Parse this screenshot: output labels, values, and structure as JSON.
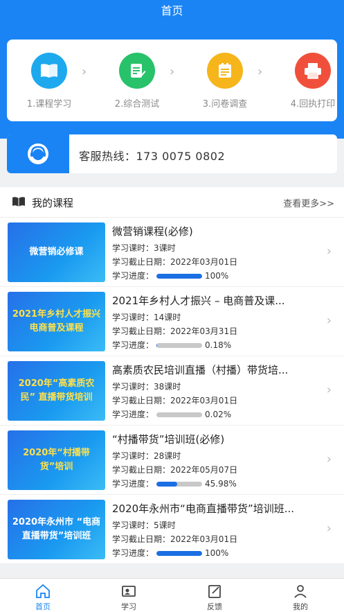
{
  "header": {
    "title": "首页"
  },
  "steps": [
    {
      "label": "1.课程学习",
      "color": "#1ea9ee",
      "icon": "book-icon"
    },
    {
      "label": "2.综合测试",
      "color": "#27c26a",
      "icon": "edit-icon"
    },
    {
      "label": "3.问卷调查",
      "color": "#f5b51b",
      "icon": "survey-icon"
    },
    {
      "label": "4.回执打印",
      "color": "#f0503b",
      "icon": "printer-icon"
    }
  ],
  "hotline": {
    "text": "客服热线：173 0075 0802",
    "icon": "customer-service-icon"
  },
  "courses_section": {
    "title": "我的课程",
    "more": "查看更多>>"
  },
  "courses": [
    {
      "thumb": "微营销必修课",
      "title": "微营销课程(必修)",
      "hours": "学习课时：3课时",
      "deadline": "学习截止日期：2022年03月01日",
      "progress_label": "学习进度：",
      "progress_pct": "100%",
      "progress": 1.0
    },
    {
      "thumb": "2021年乡村人才振兴 电商普及课程",
      "title": "2021年乡村人才振兴 – 电商普及课...",
      "hours": "学习课时：14课时",
      "deadline": "学习截止日期：2022年03月31日",
      "progress_label": "学习进度：",
      "progress_pct": "0.18%",
      "progress": 0.0018
    },
    {
      "thumb": "2020年“高素质农民” 直播带货培训",
      "title": "高素质农民培训直播（村播）带货培...",
      "hours": "学习课时：38课时",
      "deadline": "学习截止日期：2022年03月01日",
      "progress_label": "学习进度：",
      "progress_pct": "0.02%",
      "progress": 0.0002
    },
    {
      "thumb": "2020年“村播带货”培训",
      "title": "“村播带货”培训班(必修)",
      "hours": "学习课时：28课时",
      "deadline": "学习截止日期：2022年05月07日",
      "progress_label": "学习进度：",
      "progress_pct": "45.98%",
      "progress": 0.4598
    },
    {
      "thumb": "2020年永州市 “电商直播带货”培训班",
      "title": "2020年永州市“电商直播带货”培训班...",
      "hours": "学习课时：5课时",
      "deadline": "学习截止日期：2022年03月01日",
      "progress_label": "学习进度：",
      "progress_pct": "100%",
      "progress": 1.0
    }
  ],
  "tabbar": [
    {
      "label": "首页",
      "icon": "home-icon",
      "active": true
    },
    {
      "label": "学习",
      "icon": "study-icon",
      "active": false
    },
    {
      "label": "反馈",
      "icon": "feedback-icon",
      "active": false
    },
    {
      "label": "我的",
      "icon": "profile-icon",
      "active": false
    }
  ]
}
